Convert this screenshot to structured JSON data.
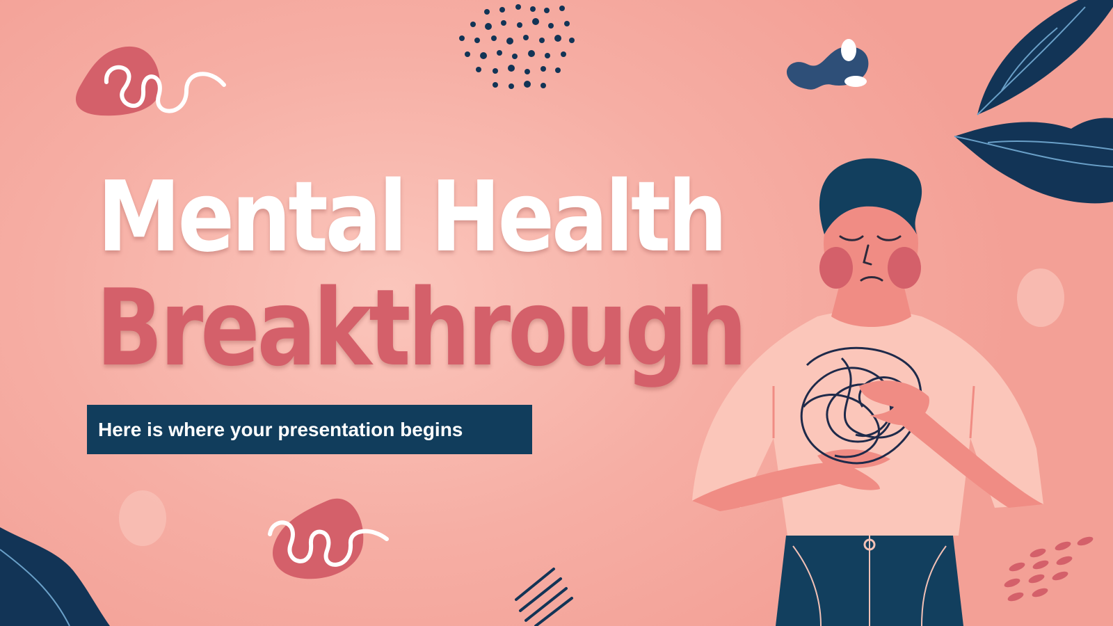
{
  "slide": {
    "title_line1": "Mental Health",
    "title_line2": "Breakthrough",
    "subtitle": "Here is where your presentation begins"
  },
  "colors": {
    "background": "#f6aea4",
    "title_primary": "#ffffff",
    "title_accent": "#d4606a",
    "subtitle_bg": "#113d5c",
    "navy": "#123456",
    "coral": "#d4606a",
    "skin": "#f08c84",
    "shirt": "#fbc6ba"
  },
  "icons": [
    "squiggle-blob-icon",
    "dot-cluster-icon",
    "leaf-icon",
    "worm-blob-icon",
    "hatch-lines-icon",
    "dash-pattern-icon",
    "tangled-scribble-icon"
  ]
}
